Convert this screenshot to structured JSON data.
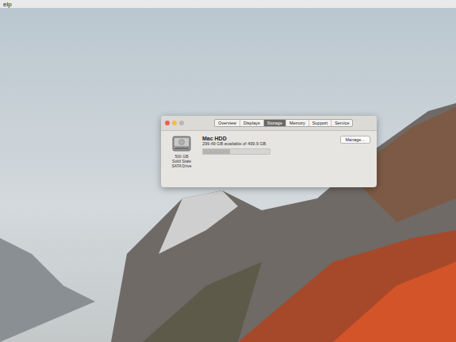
{
  "menu_bar": {
    "items": [
      "elp"
    ]
  },
  "tabs": [
    {
      "label": "Overview",
      "selected": false
    },
    {
      "label": "Displays",
      "selected": false
    },
    {
      "label": "Storage",
      "selected": true
    },
    {
      "label": "Memory",
      "selected": false
    },
    {
      "label": "Support",
      "selected": false
    },
    {
      "label": "Service",
      "selected": false
    }
  ],
  "drive": {
    "capacity": "500 GB",
    "type_lines": [
      "Solid State",
      "SATA Drive"
    ],
    "name": "Mac HDD",
    "availability": "299.49 GB available of 499.9 GB",
    "level": 0.4
  },
  "buttons": [
    "Manage..."
  ]
}
